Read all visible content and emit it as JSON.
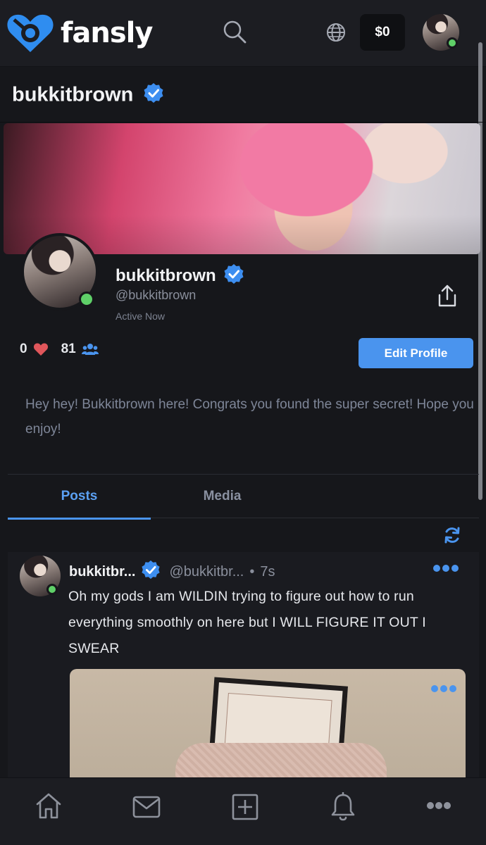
{
  "topbar": {
    "brand": "fansly",
    "wallet_balance": "$0",
    "icons": [
      "fansly-logo-icon",
      "search-icon",
      "globe-icon"
    ]
  },
  "page": {
    "title": "bukkitbrown"
  },
  "profile": {
    "display_name": "bukkitbrown",
    "handle": "@bukkitbrown",
    "status": "Active Now",
    "likes": "0",
    "followers": "81",
    "edit_label": "Edit Profile",
    "bio": "Hey hey! Bukkitbrown here! Congrats you found the super secret! Hope you enjoy!"
  },
  "tabs": [
    {
      "label": "Posts",
      "active": true
    },
    {
      "label": "Media",
      "active": false
    }
  ],
  "post": {
    "user": "bukkitbr...",
    "handle": "@bukkitbr...",
    "separator": "•",
    "time": "7s",
    "text": "Oh my gods I am WILDIN trying to figure out how to run everything smoothly on here but I WILL FIGURE IT OUT I SWEAR"
  },
  "bottom_nav": [
    "home-icon",
    "messages-icon",
    "create-post-icon",
    "notifications-icon",
    "more-icon"
  ],
  "colors": {
    "accent": "#4a94ee",
    "background": "#16171b",
    "online": "#5fd068",
    "heart": "#e0565b"
  }
}
